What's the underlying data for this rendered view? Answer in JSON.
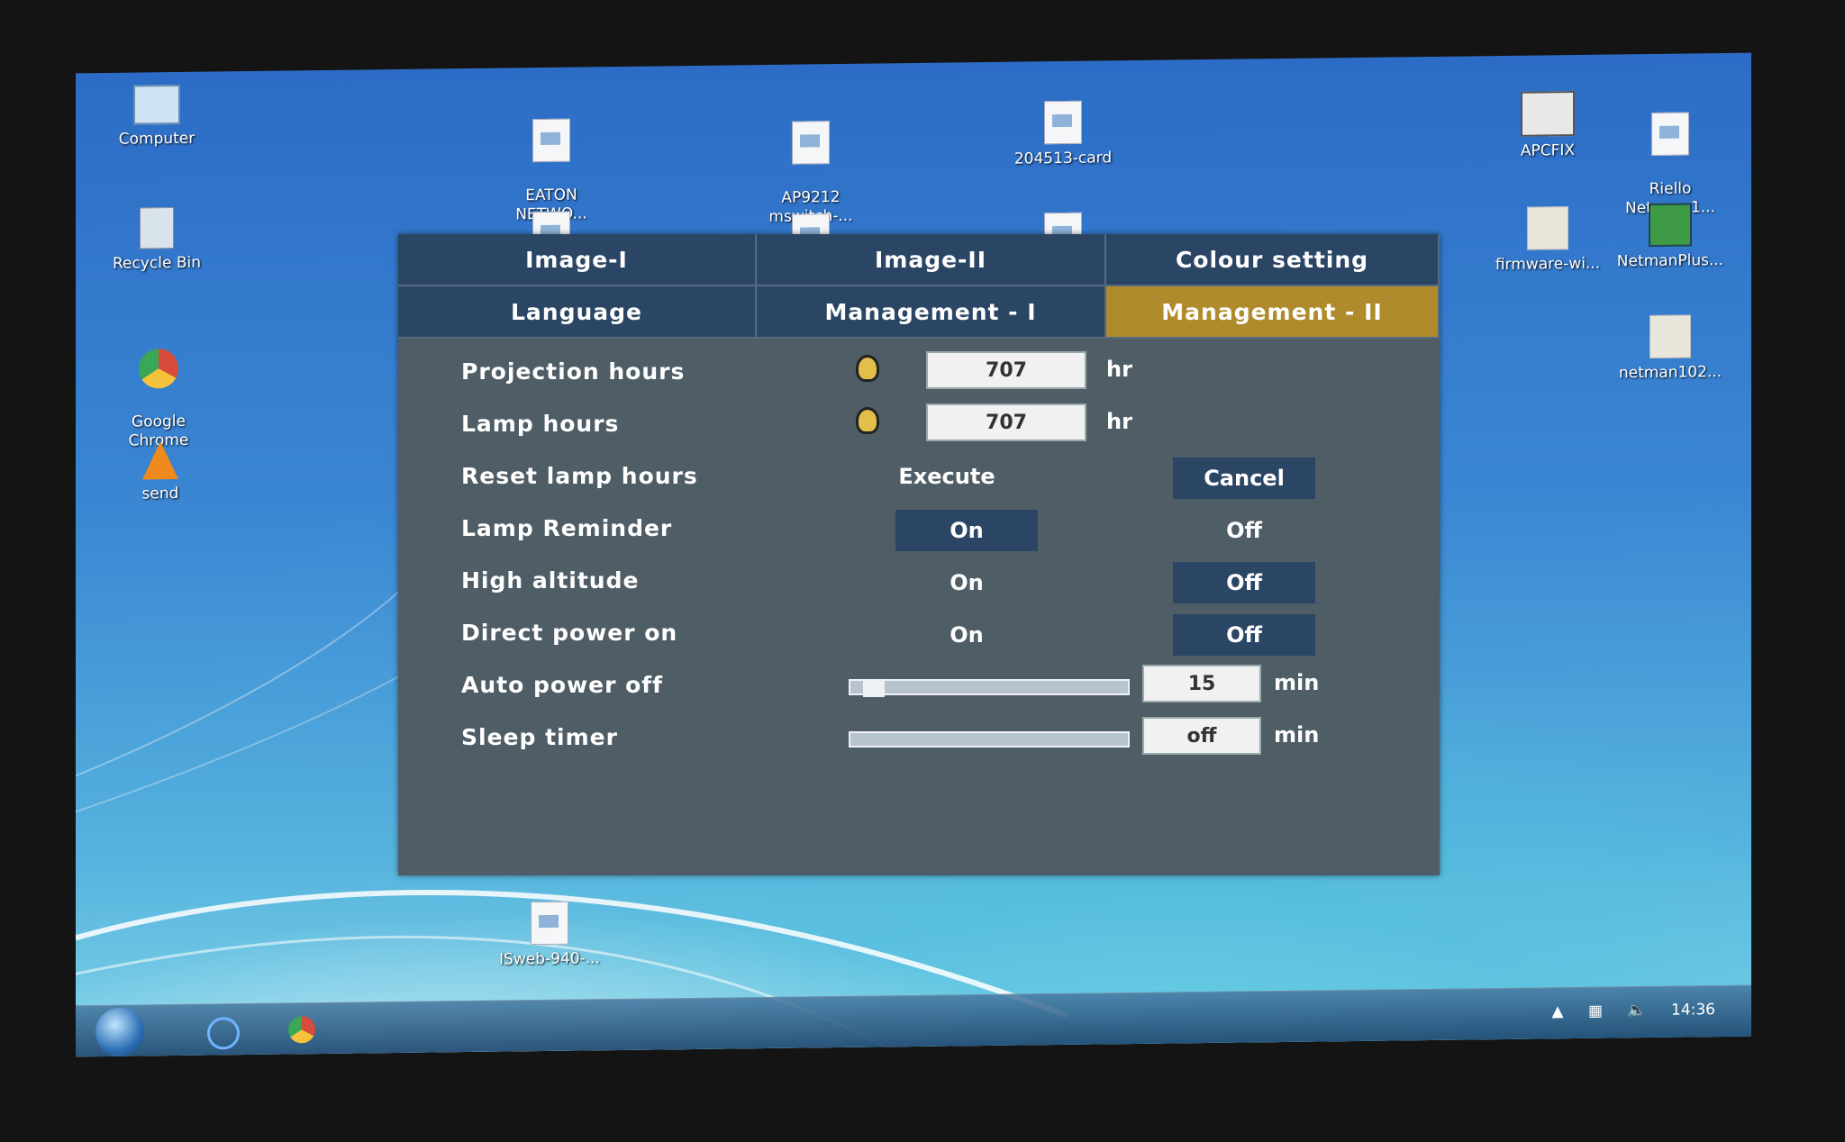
{
  "desktop": {
    "icons": [
      {
        "name": "computer",
        "label": "Computer"
      },
      {
        "name": "recycle-bin",
        "label": "Recycle Bin"
      },
      {
        "name": "google-chrome",
        "label": "Google\nChrome"
      },
      {
        "name": "vlc",
        "label": "send"
      },
      {
        "name": "eaton",
        "label": "EATON\nNETWO..."
      },
      {
        "name": "ap9212",
        "label": "AP9212\nmswitch-..."
      },
      {
        "name": "card",
        "label": "204513-card"
      },
      {
        "name": "apcfix",
        "label": "APCFIX"
      },
      {
        "name": "riello",
        "label": "Riello\nNetman 1..."
      },
      {
        "name": "firmware",
        "label": "firmware-wi..."
      },
      {
        "name": "netmanplus",
        "label": "NetmanPlus..."
      },
      {
        "name": "netman102",
        "label": "netman102..."
      },
      {
        "name": "isweb",
        "label": "ISweb-940-..."
      }
    ]
  },
  "taskbar": {
    "clock": "14:36"
  },
  "osd": {
    "tabs": [
      "Image-I",
      "Image-II",
      "Colour setting",
      "Language",
      "Management - I",
      "Management - II"
    ],
    "active_tab": "Management - II",
    "rows": {
      "projection_hours": {
        "label": "Projection hours",
        "value": "707",
        "unit": "hr"
      },
      "lamp_hours": {
        "label": "Lamp hours",
        "value": "707",
        "unit": "hr"
      },
      "reset_lamp_hours": {
        "label": "Reset lamp hours",
        "execute": "Execute",
        "cancel": "Cancel",
        "selected": "Cancel"
      },
      "lamp_reminder": {
        "label": "Lamp Reminder",
        "on": "On",
        "off": "Off",
        "selected": "On"
      },
      "high_altitude": {
        "label": "High altitude",
        "on": "On",
        "off": "Off",
        "selected": "Off"
      },
      "direct_power_on": {
        "label": "Direct power on",
        "on": "On",
        "off": "Off",
        "selected": "Off"
      },
      "auto_power_off": {
        "label": "Auto power off",
        "value": "15",
        "unit": "min",
        "level": 0.05
      },
      "sleep_timer": {
        "label": "Sleep timer",
        "value": "off",
        "unit": "min",
        "level": 0
      }
    }
  }
}
